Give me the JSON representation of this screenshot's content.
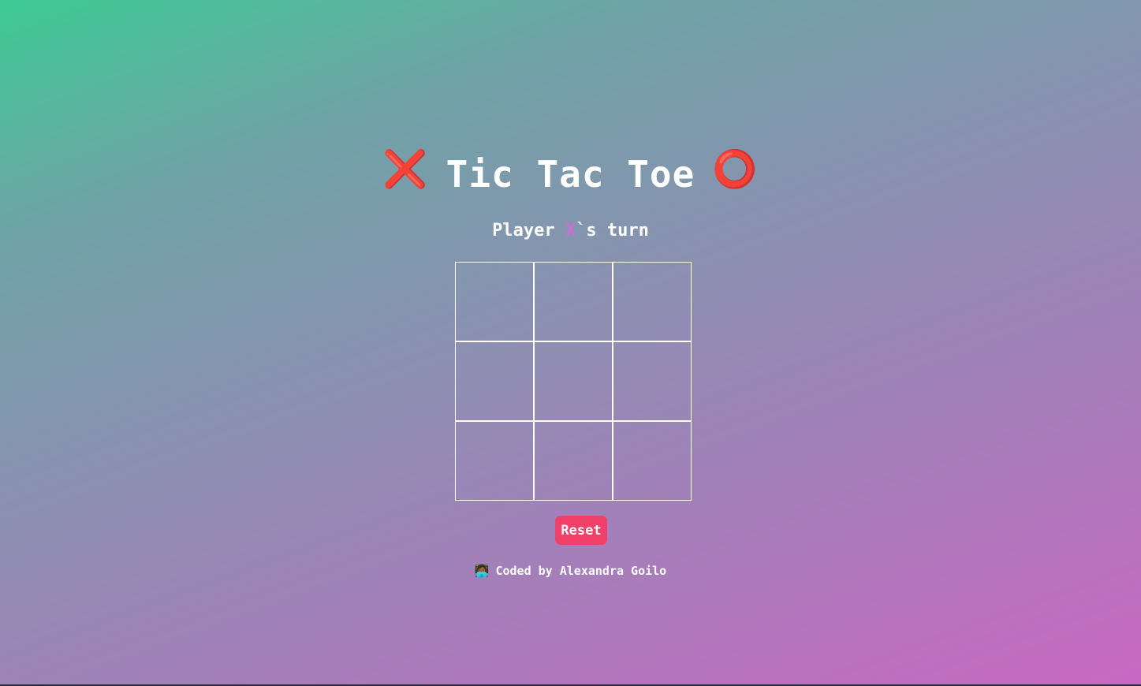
{
  "title": {
    "left_icon": "❌",
    "left_icon_name": "cross-mark-icon",
    "text": "Tic Tac Toe",
    "right_icon": "⭕",
    "right_icon_name": "hollow-circle-icon"
  },
  "status": {
    "prefix": "Player ",
    "player": "X",
    "suffix": "`s turn",
    "player_color": "#c86fd9"
  },
  "board": {
    "cells": [
      "",
      "",
      "",
      "",
      "",
      "",
      "",
      "",
      ""
    ]
  },
  "reset": {
    "label": "Reset",
    "color": "#f0406a"
  },
  "footer": {
    "emoji": "👩🏾‍💻",
    "emoji_name": "woman-technologist-icon",
    "credit": "Coded by Alexandra Goilo"
  }
}
